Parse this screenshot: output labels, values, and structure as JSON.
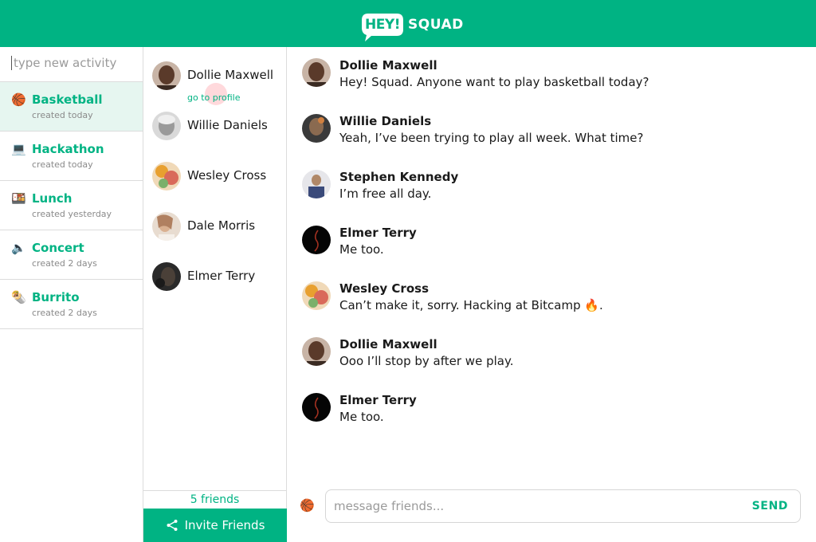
{
  "app": {
    "logo_hey": "HEY!",
    "logo_squad": "SQUAD",
    "brand_color": "#00b383"
  },
  "activities": {
    "new_placeholder": "type new activity",
    "items": [
      {
        "emoji": "🏀",
        "name": "Basketball",
        "sub": "created today",
        "active": true
      },
      {
        "emoji": "💻",
        "name": "Hackathon",
        "sub": "created today",
        "active": false
      },
      {
        "emoji": "🍱",
        "name": "Lunch",
        "sub": "created yesterday",
        "active": false
      },
      {
        "emoji": "🔈",
        "name": "Concert",
        "sub": "created 2 days",
        "active": false
      },
      {
        "emoji": "🌯",
        "name": "Burrito",
        "sub": "created 2 days",
        "active": false
      }
    ]
  },
  "friends": {
    "items": [
      {
        "name": "Dollie Maxwell",
        "link": "go to profile",
        "avatar": "avatar-dollie"
      },
      {
        "name": "Willie Daniels",
        "avatar": "avatar-willie"
      },
      {
        "name": "Wesley Cross",
        "avatar": "avatar-wesley"
      },
      {
        "name": "Dale Morris",
        "avatar": "avatar-dale"
      },
      {
        "name": "Elmer Terry",
        "avatar": "avatar-elmer"
      }
    ],
    "count_label": "5 friends",
    "invite_label": "Invite Friends"
  },
  "chat": {
    "messages": [
      {
        "name": "Dollie Maxwell",
        "text": "Hey! Squad. Anyone want to play basketball today?",
        "avatar": "avatar-dollie"
      },
      {
        "name": "Willie Daniels",
        "text": "Yeah, I’ve been trying to play all week. What time?",
        "avatar": "avatar-willie-chat"
      },
      {
        "name": "Stephen Kennedy",
        "text": "I’m free all day.",
        "avatar": "avatar-stephen"
      },
      {
        "name": "Elmer Terry",
        "text": "Me too.",
        "avatar": "avatar-elmer-dark"
      },
      {
        "name": "Wesley Cross",
        "text": "Can’t make it, sorry. Hacking at Bitcamp 🔥.",
        "avatar": "avatar-wesley"
      },
      {
        "name": "Dollie Maxwell",
        "text": "Ooo I’ll stop by after we play.",
        "avatar": "avatar-dollie"
      },
      {
        "name": "Elmer Terry",
        "text": "Me too.",
        "avatar": "avatar-elmer-dark"
      }
    ],
    "composer_emoji": "🏀",
    "composer_placeholder": "message friends...",
    "send_label": "SEND"
  }
}
